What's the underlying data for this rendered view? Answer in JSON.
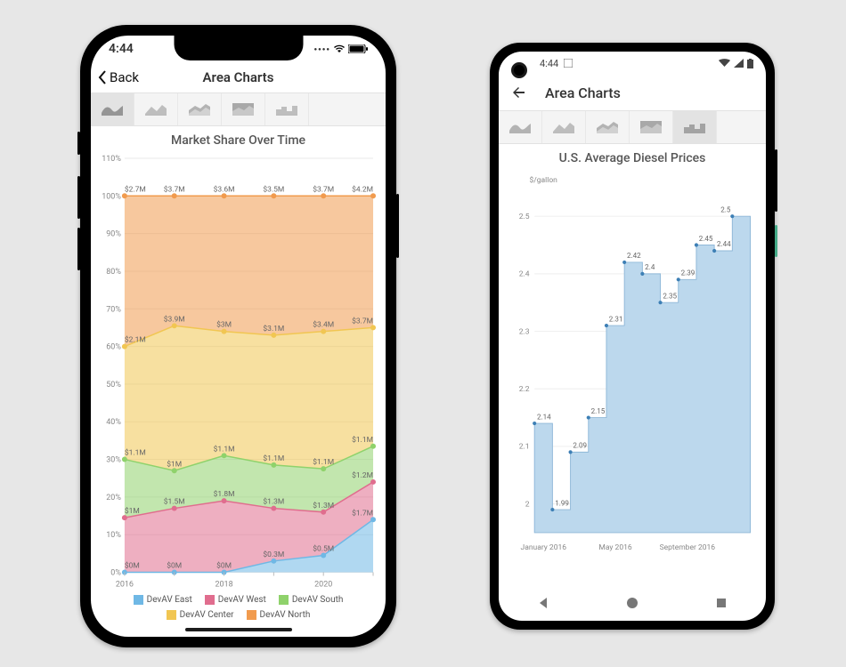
{
  "ios": {
    "status_time": "4:44",
    "back_label": "Back",
    "page_title": "Area Charts",
    "chart_title": "Market Share Over Time",
    "legend": [
      "DevAV East",
      "DevAV West",
      "DevAV South",
      "DevAV Center",
      "DevAV North"
    ],
    "colors": [
      "#6fb8e5",
      "#e06d8e",
      "#8fd26b",
      "#f1c652",
      "#f19b4e"
    ],
    "years": [
      "2016",
      "2018",
      "2020"
    ]
  },
  "android": {
    "status_time": "4:44",
    "page_title": "Area Charts",
    "chart_title": "U.S. Average Diesel Prices",
    "y_unit": "$/gallon"
  },
  "chart_data": [
    {
      "type": "area",
      "stacked_percent": true,
      "title": "Market Share Over Time",
      "xlabel": "",
      "ylabel": "",
      "ylim": [
        0,
        110
      ],
      "x": [
        2016,
        2017,
        2018,
        2019,
        2020,
        2021
      ],
      "ytick_labels": [
        "0%",
        "10%",
        "20%",
        "30%",
        "40%",
        "50%",
        "60%",
        "70%",
        "80%",
        "90%",
        "100%",
        "110%"
      ],
      "series": [
        {
          "name": "DevAV East",
          "color": "#6fb8e5",
          "values_M$": [
            0,
            0,
            0,
            0.3,
            0.5,
            1.7
          ]
        },
        {
          "name": "DevAV West",
          "color": "#e06d8e",
          "values_M$": [
            1.0,
            1.5,
            1.8,
            1.3,
            1.3,
            1.2
          ]
        },
        {
          "name": "DevAV South",
          "color": "#8fd26b",
          "values_M$": [
            1.1,
            1.0,
            1.1,
            1.1,
            1.1,
            1.1
          ]
        },
        {
          "name": "DevAV Center",
          "color": "#f1c652",
          "values_M$": [
            2.1,
            3.9,
            3.0,
            3.1,
            3.4,
            3.7
          ]
        },
        {
          "name": "DevAV North",
          "color": "#f19b4e",
          "values_M$": [
            2.7,
            3.7,
            3.6,
            3.5,
            3.7,
            4.2
          ]
        }
      ],
      "stack_percent": {
        "east": [
          0,
          0,
          0,
          3,
          4.5,
          14
        ],
        "west": [
          14.5,
          17,
          19,
          17,
          16,
          24
        ],
        "south": [
          30,
          27,
          31,
          28.5,
          27.5,
          33.5
        ],
        "center": [
          60,
          65.5,
          64,
          63,
          64,
          65
        ],
        "north": [
          100,
          100,
          100,
          100,
          100,
          100
        ]
      },
      "data_labels": {
        "north": [
          "$2.7M",
          "$3.7M",
          "$3.6M",
          "$3.5M",
          "$3.7M",
          "$4.2M"
        ],
        "center": [
          "$2.1M",
          "$3.9M",
          "$3M",
          "$3.1M",
          "$3.4M",
          "$3.7M"
        ],
        "south": [
          "$1.1M",
          "$1M",
          "$1.1M",
          "$1.1M",
          "$1.1M",
          "$1.1M"
        ],
        "west": [
          "$1M",
          "$1.5M",
          "$1.8M",
          "$1.3M",
          "$1.3M",
          "$1.2M"
        ],
        "east": [
          "$0M",
          "$0M",
          "$0M",
          "$0.3M",
          "$0.5M",
          "$1.7M"
        ]
      }
    },
    {
      "type": "area",
      "step": true,
      "title": "U.S. Average Diesel Prices",
      "xlabel": "",
      "ylabel": "$/gallon",
      "ylim": [
        1.95,
        2.55
      ],
      "yticks": [
        2.0,
        2.1,
        2.2,
        2.3,
        2.4,
        2.5
      ],
      "x_labels": [
        "January 2016",
        "May 2016",
        "September 2016"
      ],
      "x_months": [
        "Jan",
        "Feb",
        "Mar",
        "Apr",
        "May",
        "Jun",
        "Jul",
        "Aug",
        "Sep",
        "Oct",
        "Nov",
        "Dec"
      ],
      "values": [
        2.14,
        1.99,
        2.09,
        2.15,
        2.31,
        2.42,
        2.4,
        2.35,
        2.39,
        2.45,
        2.44,
        2.5
      ],
      "color": "#bcd8ed"
    }
  ]
}
